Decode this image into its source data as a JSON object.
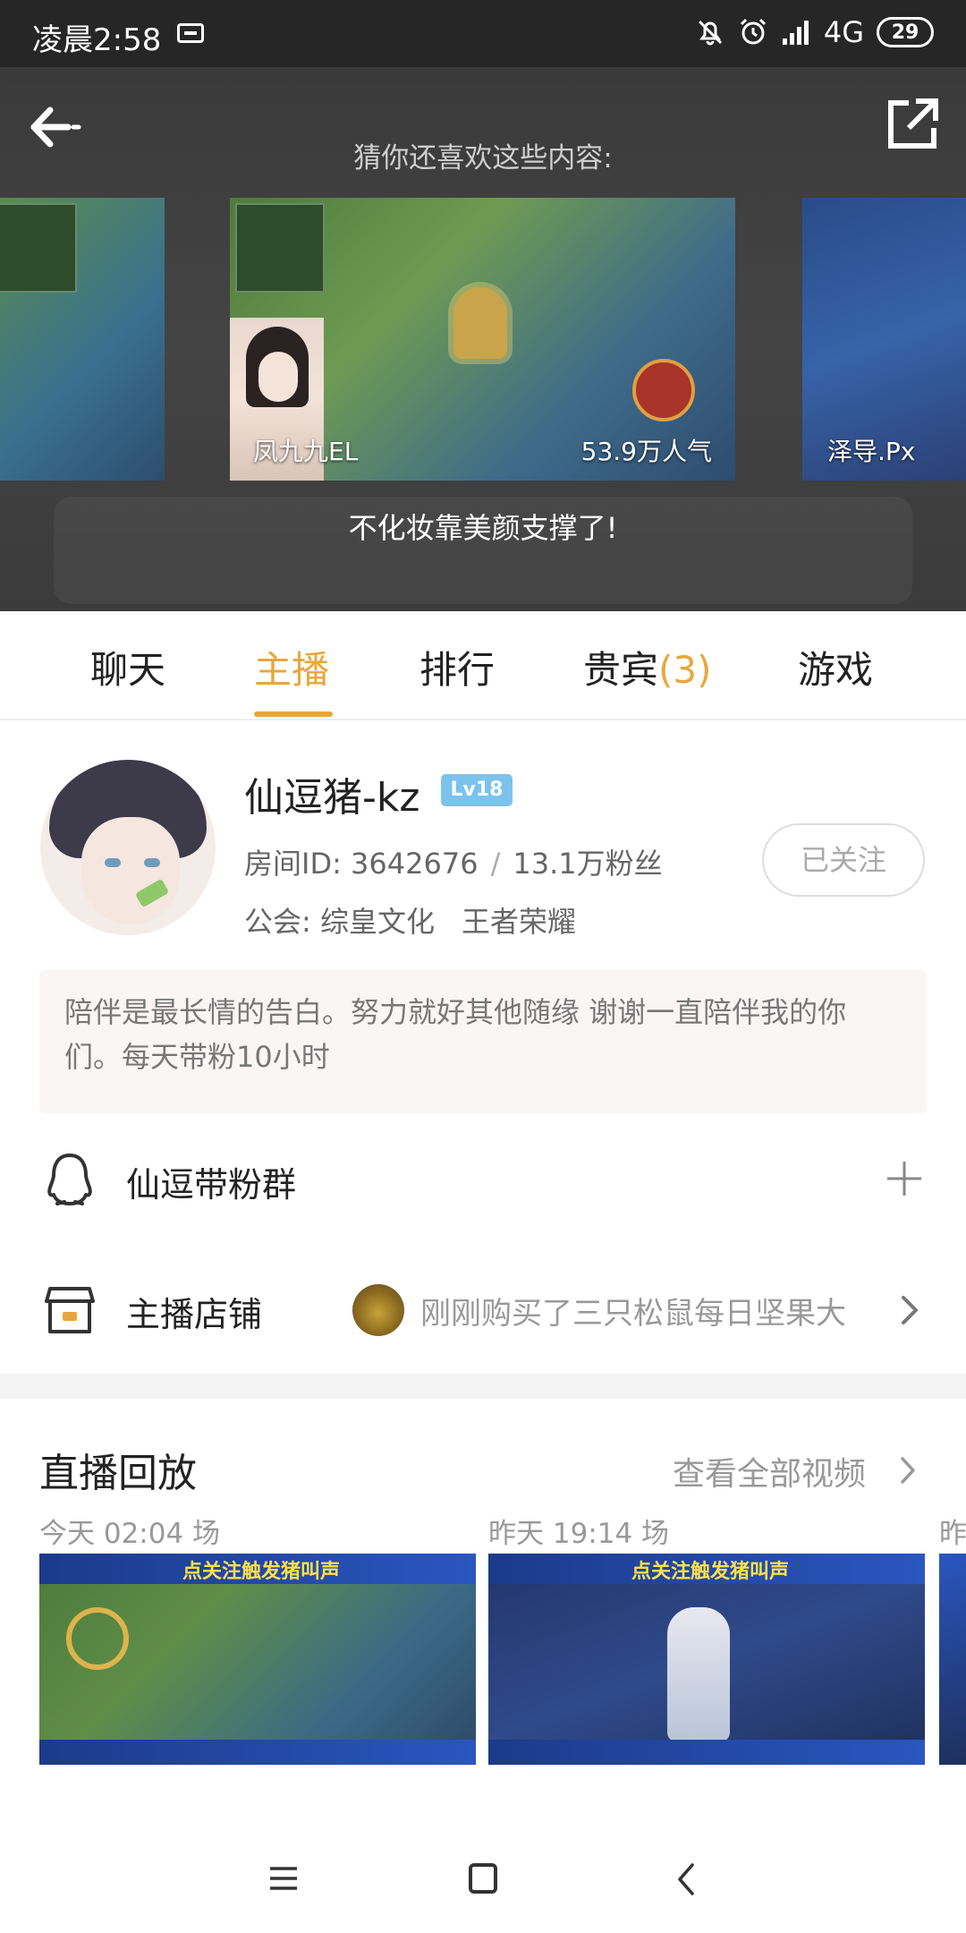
{
  "status_bar": {
    "time": "凌晨2:58",
    "network": "4G",
    "battery": "29"
  },
  "recommend": {
    "title": "猜你还喜欢这些内容:",
    "cards": [
      {
        "name": "",
        "popularity": ""
      },
      {
        "name": "凤九九EL",
        "popularity": "53.9万人气"
      },
      {
        "name": "泽导.Px",
        "popularity": ""
      }
    ],
    "caption": "不化妆靠美颜支撑了!"
  },
  "tabs": {
    "items": [
      "聊天",
      "主播",
      "排行",
      "贵宾",
      "游戏"
    ],
    "vip_count": "(3)",
    "active": "主播"
  },
  "anchor": {
    "name": "仙逗猪-kz",
    "level": "Lv18",
    "room_id": "房间ID: 3642676",
    "fans": "13.1万粉丝",
    "guild": "公会: 综皇文化",
    "game": "王者荣耀",
    "follow_label": "已关注",
    "bio": "陪伴是最长情的告白。努力就好其他随缘    谢谢一直陪伴我的你们。每天带粉10小时"
  },
  "fan_group": {
    "label": "仙逗带粉群"
  },
  "shop": {
    "label": "主播店铺",
    "recent": "刚刚购买了三只松鼠每日坚果大"
  },
  "replay": {
    "title": "直播回放",
    "see_all": "查看全部视频",
    "items": [
      {
        "meta": "今天 02:04 场",
        "banner": "点关注触发猪叫声"
      },
      {
        "meta": "昨天 19:14 场",
        "banner": "点关注触发猪叫声"
      },
      {
        "meta": "昨",
        "banner": ""
      }
    ]
  },
  "colors": {
    "accent": "#e8a73c",
    "level_badge": "#7cc3ec",
    "status_bar": "#262626"
  }
}
